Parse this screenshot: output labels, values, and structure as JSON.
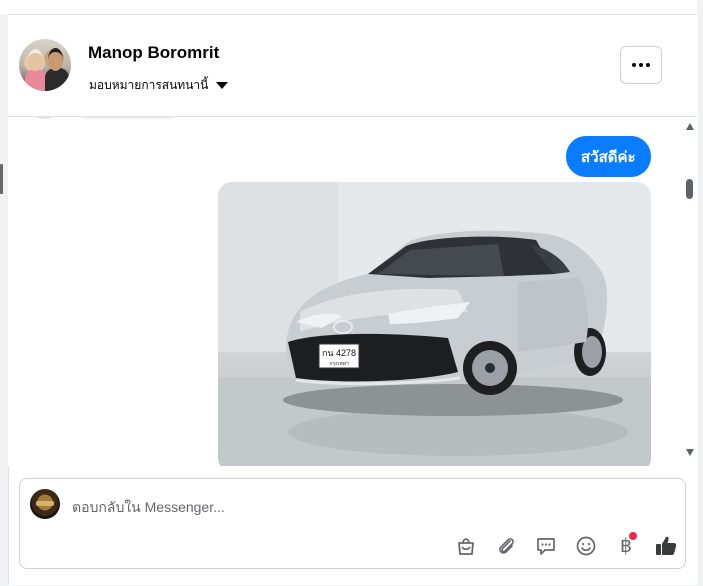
{
  "header": {
    "name": "Manop Boromrit",
    "assign_label": "มอบหมายการสนทนานี้"
  },
  "thread": {
    "messages": [
      {
        "type": "text",
        "text": "สวัสดีค่ะ"
      }
    ],
    "car_plate": "กน 4278",
    "car_plate_province": "กรุงเทพฯ"
  },
  "composer": {
    "placeholder": "ตอบกลับใน Messenger..."
  },
  "colors": {
    "accent": "#0a7cff",
    "badge": "#f02849",
    "icon": "#65676b"
  }
}
